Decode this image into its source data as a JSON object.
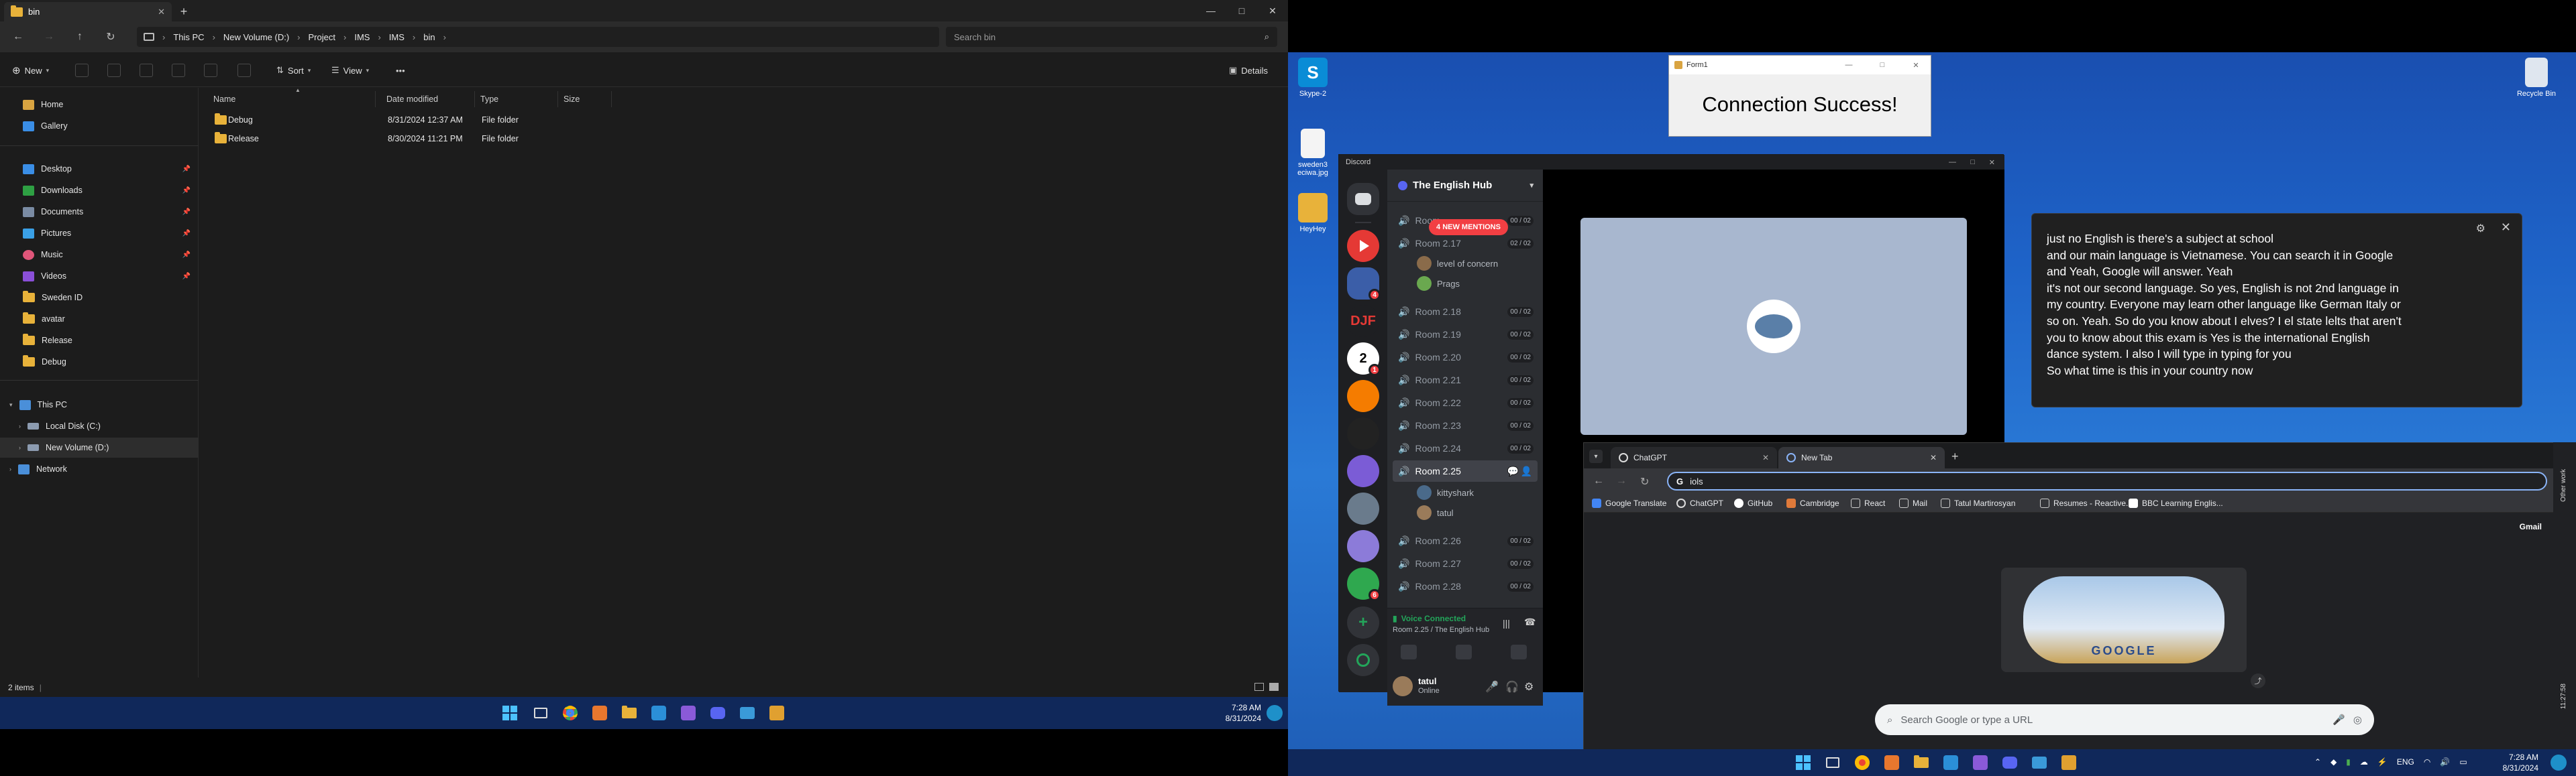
{
  "explorer": {
    "tab_title": "bin",
    "window_controls": [
      "—",
      "□",
      "✕"
    ],
    "breadcrumb": [
      "This PC",
      "New Volume (D:)",
      "Project",
      "IMS",
      "IMS",
      "bin"
    ],
    "search_placeholder": "Search bin",
    "toolbar": {
      "new": "New",
      "sort": "Sort",
      "view": "View",
      "more": "•••",
      "details": "Details"
    },
    "nav": [
      {
        "label": "Home",
        "icon": "home-icon"
      },
      {
        "label": "Gallery",
        "icon": "gallery-icon"
      },
      {
        "label": "Desktop",
        "icon": "desktop-icon",
        "pinned": true
      },
      {
        "label": "Downloads",
        "icon": "downloads-icon",
        "pinned": true
      },
      {
        "label": "Documents",
        "icon": "documents-icon",
        "pinned": true
      },
      {
        "label": "Pictures",
        "icon": "pictures-icon",
        "pinned": true
      },
      {
        "label": "Music",
        "icon": "music-icon",
        "pinned": true
      },
      {
        "label": "Videos",
        "icon": "videos-icon",
        "pinned": true
      },
      {
        "label": "Sweden ID",
        "icon": "folder-icon"
      },
      {
        "label": "avatar",
        "icon": "folder-icon"
      },
      {
        "label": "Release",
        "icon": "folder-icon"
      },
      {
        "label": "Debug",
        "icon": "folder-icon"
      }
    ],
    "tree": [
      {
        "label": "This PC",
        "icon": "this-pc-icon"
      },
      {
        "label": "Local Disk (C:)",
        "icon": "drive-icon"
      },
      {
        "label": "New Volume (D:)",
        "icon": "drive-icon"
      },
      {
        "label": "Network",
        "icon": "network-icon"
      }
    ],
    "columns": [
      "Name",
      "Date modified",
      "Type",
      "Size"
    ],
    "files": [
      {
        "name": "Debug",
        "date": "8/31/2024 12:37 AM",
        "type": "File folder",
        "size": ""
      },
      {
        "name": "Release",
        "date": "8/30/2024 11:21 PM",
        "type": "File folder",
        "size": ""
      }
    ],
    "status": "2 items"
  },
  "taskbar_left": {
    "time": "7:28 AM",
    "date": "8/31/2024"
  },
  "taskbar_right": {
    "time": "7:28 AM",
    "date": "8/31/2024",
    "lang": "ENG"
  },
  "desktop_icons": {
    "skype": "Skype-2",
    "image": "sweden3 eciwa.jpg",
    "folder": "HeyHey",
    "recycle": "Recycle Bin"
  },
  "form1": {
    "title": "Form1",
    "message": "Connection Success!"
  },
  "discord": {
    "window_title": "Discord",
    "guild": "The English Hub",
    "new_mentions": "4 NEW MENTIONS",
    "channels": [
      {
        "name": "Room",
        "count": "00 / 02"
      },
      {
        "name": "Room 2.17",
        "count": "02 / 02"
      },
      {
        "name": "Room 2.18",
        "count": "00 / 02"
      },
      {
        "name": "Room 2.19",
        "count": "00 / 02"
      },
      {
        "name": "Room 2.20",
        "count": "00 / 02"
      },
      {
        "name": "Room 2.21",
        "count": "00 / 02"
      },
      {
        "name": "Room 2.22",
        "count": "00 / 02"
      },
      {
        "name": "Room 2.23",
        "count": "00 / 02"
      },
      {
        "name": "Room 2.24",
        "count": "00 / 02"
      },
      {
        "name": "Room 2.25",
        "count": ""
      },
      {
        "name": "Room 2.26",
        "count": "00 / 02"
      },
      {
        "name": "Room 2.27",
        "count": "00 / 02"
      },
      {
        "name": "Room 2.28",
        "count": "00 / 02"
      }
    ],
    "users_217": [
      "level of concern",
      "Prags"
    ],
    "users_225": [
      "kittyshark",
      "tatul"
    ],
    "voice_status": "Voice Connected",
    "voice_location": "Room 2.25 / The English Hub",
    "username": "tatul",
    "user_status": "Online",
    "server_labels": [
      "DJF",
      "2"
    ]
  },
  "caption": {
    "lines": [
      "just no English is there's a subject at school",
      "and our main language is Vietnamese. You can search it in Google",
      "and Yeah, Google will answer. Yeah",
      "it's not our second language. So yes, English is not 2nd language in",
      "my country. Everyone may learn other language like German Italy or",
      "so on. Yeah. So do you know about I elves? I el state lelts that aren't",
      "you to know about this exam is Yes is the international English",
      "dance system. I also I will type in typing for you",
      "So what time is this in your country now"
    ]
  },
  "chrome": {
    "tabs": [
      "ChatGPT",
      "New Tab"
    ],
    "omnibox": "iols",
    "bookmarks": [
      "Google Translate",
      "ChatGPT",
      "GitHub",
      "Cambridge",
      "React",
      "Mail",
      "Tatul Martirosyan",
      "Resumes - Reactive...",
      "BBC Learning Englis..."
    ],
    "gmail": "Gmail",
    "search_placeholder": "Search Google or type a URL",
    "doodle_text": "GOOGLE"
  },
  "side_strip": {
    "label1": "Other work",
    "label2": "11:27:58"
  }
}
